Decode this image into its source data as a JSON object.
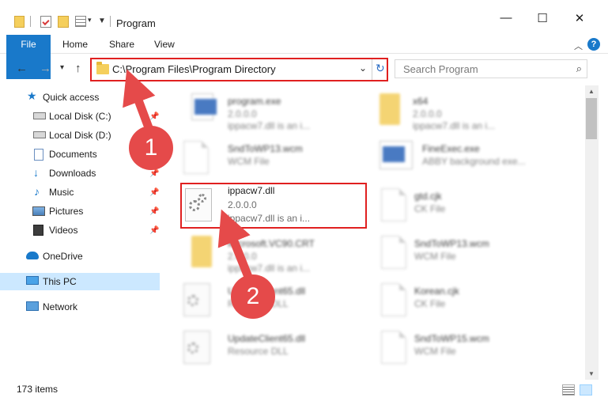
{
  "window": {
    "title": "Program",
    "minimize": "—",
    "maximize": "☐",
    "close": "✕"
  },
  "ribbon": {
    "tabs": [
      "File",
      "Home",
      "Share",
      "View"
    ],
    "help": "?"
  },
  "address": {
    "path": "C:\\Program Files\\Program Directory"
  },
  "search": {
    "placeholder": "Search Program"
  },
  "sidebar": {
    "items": [
      {
        "label": "Quick access",
        "icon": "star-icon"
      },
      {
        "label": "Local Disk (C:)",
        "icon": "drive-icon"
      },
      {
        "label": "Local Disk (D:)",
        "icon": "drive-icon"
      },
      {
        "label": "Documents",
        "icon": "documents-icon"
      },
      {
        "label": "Downloads",
        "icon": "download-icon"
      },
      {
        "label": "Music",
        "icon": "music-icon"
      },
      {
        "label": "Pictures",
        "icon": "pictures-icon"
      },
      {
        "label": "Videos",
        "icon": "videos-icon"
      },
      {
        "label": "OneDrive",
        "icon": "cloud-icon"
      },
      {
        "label": "This PC",
        "icon": "computer-icon"
      },
      {
        "label": "Network",
        "icon": "network-icon"
      }
    ]
  },
  "files": [
    {
      "name": "program.exe",
      "meta1": "2.0.0.0",
      "meta2": "ippacw7.dll is an i...",
      "icon": "exe-icon"
    },
    {
      "name": "x64",
      "meta1": "2.0.0.0",
      "meta2": "ippacw7.dll is an i...",
      "icon": "folder-icon"
    },
    {
      "name": "SndToWP13.wcm",
      "meta1": "WCM File",
      "meta2": "",
      "icon": "file-icon"
    },
    {
      "name": "FineExec.exe",
      "meta1": "ABBY background exe...",
      "meta2": "",
      "icon": "app-icon"
    },
    {
      "name": "ippacw7.dll",
      "meta1": "2.0.0.0",
      "meta2": "ippacw7.dll is an i...",
      "icon": "dll-icon"
    },
    {
      "name": "gtd.cjk",
      "meta1": "CK File",
      "meta2": "",
      "icon": "file-icon"
    },
    {
      "name": "Microsoft.VC90.CRT",
      "meta1": "2.0.0.0",
      "meta2": "ippacw7.dll is an i...",
      "icon": "folder-icon"
    },
    {
      "name": "SndToWP13.wcm",
      "meta1": "WCM File",
      "meta2": "",
      "icon": "file-icon"
    },
    {
      "name": "UpdateClient65.dll",
      "meta1": "Resource DLL",
      "meta2": "",
      "icon": "dll-icon"
    },
    {
      "name": "Korean.cjk",
      "meta1": "CK File",
      "meta2": "",
      "icon": "file-icon"
    },
    {
      "name": "UpdateClient65.dll",
      "meta1": "Resource DLL",
      "meta2": "",
      "icon": "dll-icon"
    },
    {
      "name": "SndToWP15.wcm",
      "meta1": "WCM File",
      "meta2": "",
      "icon": "file-icon"
    }
  ],
  "status": {
    "count": "173 items"
  },
  "annotations": {
    "step1": "1",
    "step2": "2",
    "color": "#e54a4a"
  }
}
